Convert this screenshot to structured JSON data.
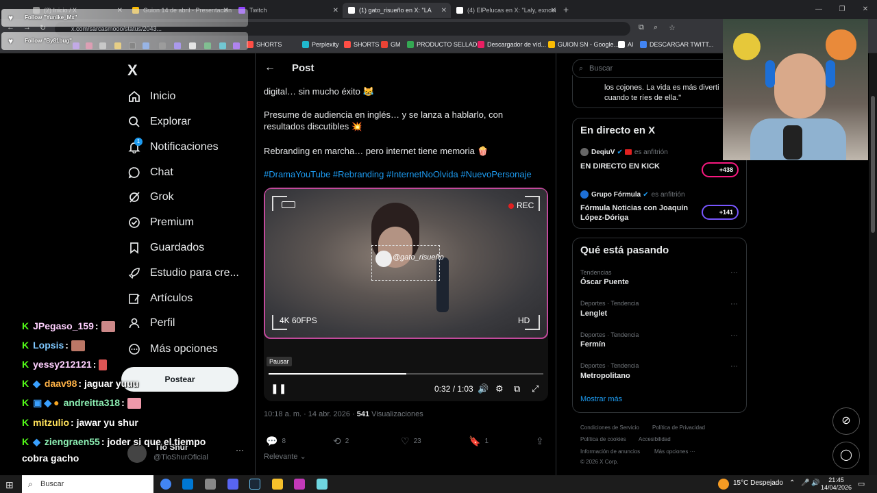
{
  "browser": {
    "tabs": [
      {
        "label": "(2) Inicio / X",
        "color": "#8a8a8a"
      },
      {
        "label": "Guion 14 de abril - Presentación",
        "color": "#fbbc04"
      },
      {
        "label": "Twitch",
        "color": "#9146ff"
      },
      {
        "label": "(1) gato_risueño en X: \"LA",
        "color": "#ffffff"
      },
      {
        "label": "(4) ElPelucas en X: \"Laly, exnovi",
        "color": "#ffffff"
      }
    ],
    "new_tab": "+",
    "url": "x.com/sarcasmooo/status/2043..."
  },
  "bookmarks": [
    {
      "label": "SHORTS",
      "color": "#ff4e45"
    },
    {
      "label": "Perplexity",
      "color": "#20b8cd"
    },
    {
      "label": "SHORTS",
      "color": "#ff4e45"
    },
    {
      "label": "GM",
      "color": "#ea4335"
    },
    {
      "label": "PRODUCTO SELLAD...",
      "color": "#34a853"
    },
    {
      "label": "Descargador de víd...",
      "color": "#e91e63"
    },
    {
      "label": "GUION SN - Google...",
      "color": "#fbbc04"
    },
    {
      "label": "AI",
      "color": "#ffffff"
    },
    {
      "label": "DESCARGAR TWITT...",
      "color": "#4285f4"
    }
  ],
  "nav": {
    "logo": "X",
    "items": [
      {
        "label": "Inicio",
        "icon": "home-icon"
      },
      {
        "label": "Explorar",
        "icon": "search-icon"
      },
      {
        "label": "Notificaciones",
        "icon": "bell-icon"
      },
      {
        "label": "Chat",
        "icon": "chat-icon"
      },
      {
        "label": "Grok",
        "icon": "grok-icon"
      },
      {
        "label": "Premium",
        "icon": "premium-icon"
      },
      {
        "label": "Guardados",
        "icon": "bookmark-icon"
      },
      {
        "label": "Estudio para cre...",
        "icon": "rocket-icon"
      },
      {
        "label": "Artículos",
        "icon": "article-icon"
      },
      {
        "label": "Perfil",
        "icon": "person-icon"
      },
      {
        "label": "Más opciones",
        "icon": "more-icon"
      }
    ],
    "notif_count": "1",
    "post_button": "Postear",
    "profile_name": "Tío Shur",
    "profile_handle": "@TioShurOficial",
    "profile_more": "···"
  },
  "post": {
    "header_title": "Post",
    "text1": "digital… sin mucho éxito 😹",
    "text2": "Presume de audiencia en inglés… y se lanza a hablarlo, con resultados discutibles 💥",
    "text3": "Rebranding en marcha… pero internet tiene memoria 🍿",
    "hashtags": "#DramaYouTube #Rebranding #InternetNoOlvida #NuevoPersonaje",
    "video": {
      "rec": "REC",
      "quality_left": "4K 60FPS",
      "quality_right": "HD",
      "watermark": "@gato_risueño",
      "tooltip": "Pausar",
      "time": "0:32 / 1:03",
      "progress": 0.5
    },
    "meta_time": "10:18 a. m. · 14 abr. 2026 · ",
    "meta_views_count": "541",
    "meta_views_label": " Visualizaciones",
    "actions": {
      "replies": "8",
      "reposts": "2",
      "likes": "23",
      "bookmarks": "1"
    },
    "sort": "Relevante"
  },
  "right": {
    "search_placeholder": "Buscar",
    "snippet_line1": "los cojones. La vida es más diverti",
    "snippet_line2": "cuando te ríes de ella.\"",
    "live_title": "En directo en X",
    "live": [
      {
        "host": "DeqiuV",
        "role": "es anfitrión",
        "title": "EN DIRECTO EN KICK",
        "count": "+438"
      },
      {
        "host": "Grupo Fórmula",
        "role": "es anfitrión",
        "title": "Fórmula Noticias con Joaquín López-Dóriga",
        "count": "+141"
      }
    ],
    "trends_title": "Qué está pasando",
    "trends": [
      {
        "category": "Tendencias",
        "name": "Óscar Puente"
      },
      {
        "category": "Deportes · Tendencia",
        "name": "Lenglet"
      },
      {
        "category": "Deportes · Tendencia",
        "name": "Fermín"
      },
      {
        "category": "Deportes · Tendencia",
        "name": "Metropolitano"
      }
    ],
    "show_more": "Mostrar más",
    "footer": [
      "Condiciones de Servicio",
      "Política de Privacidad",
      "Política de cookies",
      "Accesibilidad",
      "Información de anuncios",
      "Más opciones ···",
      "© 2026 X Corp."
    ]
  },
  "overlay": {
    "follows": [
      "Follow \"Yunike_Mx\"",
      "Follow \"By81bug\""
    ],
    "chat": [
      {
        "user": "JPegaso_159",
        "msg": ":",
        "color": "#ffd0ff"
      },
      {
        "user": "Lopsis",
        "msg": ":",
        "color": "#7ec8ff"
      },
      {
        "user": "yessy212121",
        "msg": ":",
        "color": "#ffd0ff"
      },
      {
        "user": "daav98",
        "msg": ": jaguar yuuu",
        "color": "#ffb347"
      },
      {
        "user": "andreitta318",
        "msg": ":",
        "color": "#8df0b4"
      },
      {
        "user": "mitzulio",
        "msg": ": jawar yu shur",
        "color": "#ffe15a"
      },
      {
        "user": "ziengraen55",
        "msg": ": joder si que el tiempo",
        "color": "#8df0b4"
      }
    ],
    "chat_continuation": "cobra gacho"
  },
  "taskbar": {
    "search": "Buscar",
    "weather": "15°C  Despejado",
    "time": "21:45",
    "date": "14/04/2026"
  }
}
